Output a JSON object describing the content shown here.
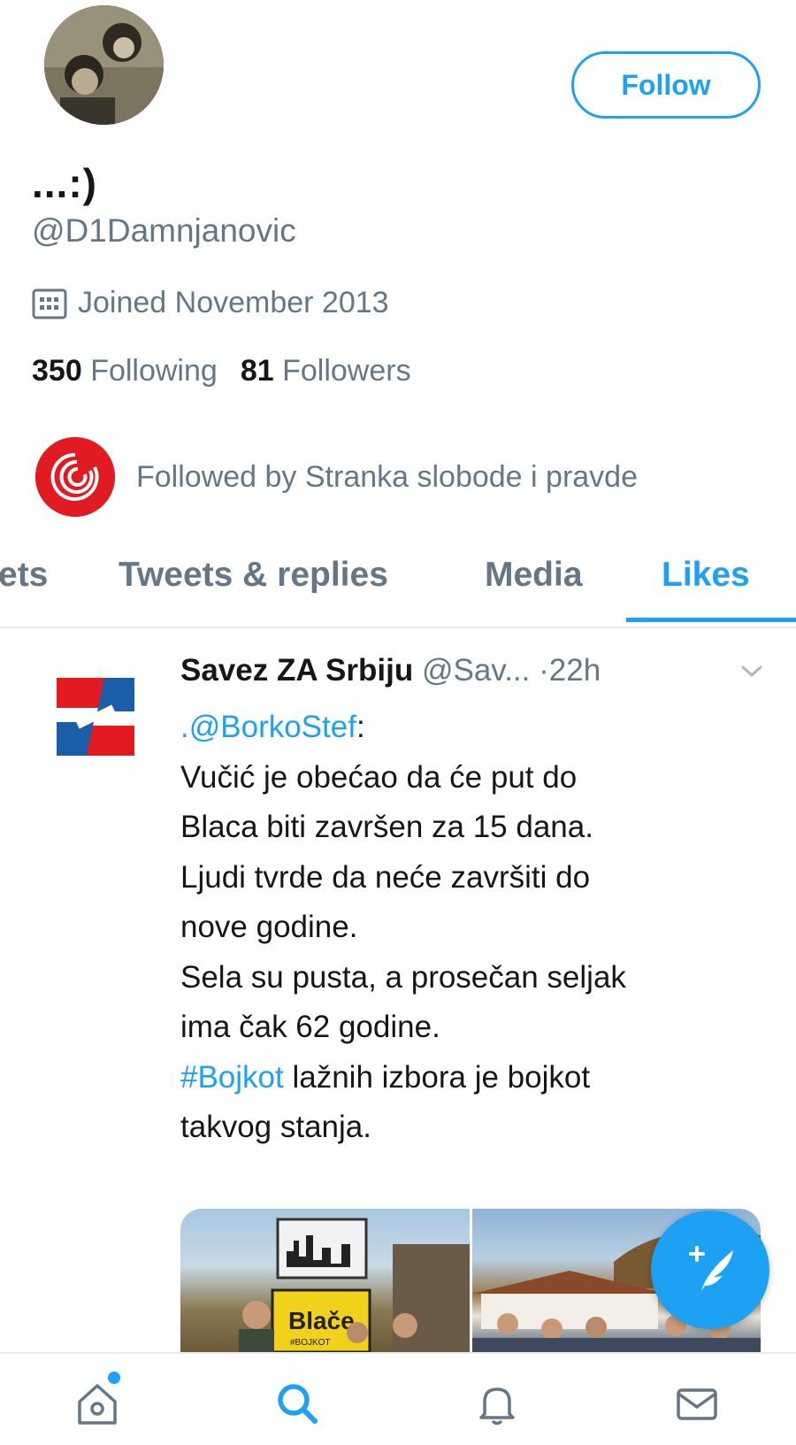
{
  "profile": {
    "display_name": "...:)",
    "handle": "@D1Damnjanovic",
    "joined": "Joined November 2013",
    "following_count": "350",
    "following_label": "Following",
    "followers_count": "81",
    "followers_label": "Followers",
    "followed_by": "Followed by Stranka slobode i pravde",
    "follow_label": "Follow"
  },
  "tabs": [
    {
      "label": "ets"
    },
    {
      "label": "Tweets & replies"
    },
    {
      "label": "Media"
    },
    {
      "label": "Likes",
      "active": true
    }
  ],
  "tweet": {
    "author_name": "Savez ZA Srbiju",
    "author_handle": "@Sav...",
    "time": "·22h",
    "mention": ".@BorkoStef",
    "mention_suffix": ":",
    "body_main": "Vučić je obećao da će put do\nBlaca biti završen za 15 dana.\nLjudi tvrde da neće završiti do\nnove godine.\nSela su pusta, a prosečan seljak\nima čak 62 godine.\n",
    "hashtag": "#Bojkot",
    "body_end": " lažnih izbora je bojkot\ntakvog stanja.",
    "sign_text": "Blače",
    "sign_small": "#BOJKOT"
  },
  "icons": {
    "calendar": "calendar-icon",
    "compose": "compose-tweet-icon",
    "home": "home-icon",
    "search": "search-icon",
    "notifications": "bell-icon",
    "messages": "mail-icon",
    "chevron": "chevron-down-icon"
  },
  "colors": {
    "accent": "#1da1f2",
    "muted": "#657786",
    "text": "#14171a",
    "followed_logo": "#e21b22"
  }
}
